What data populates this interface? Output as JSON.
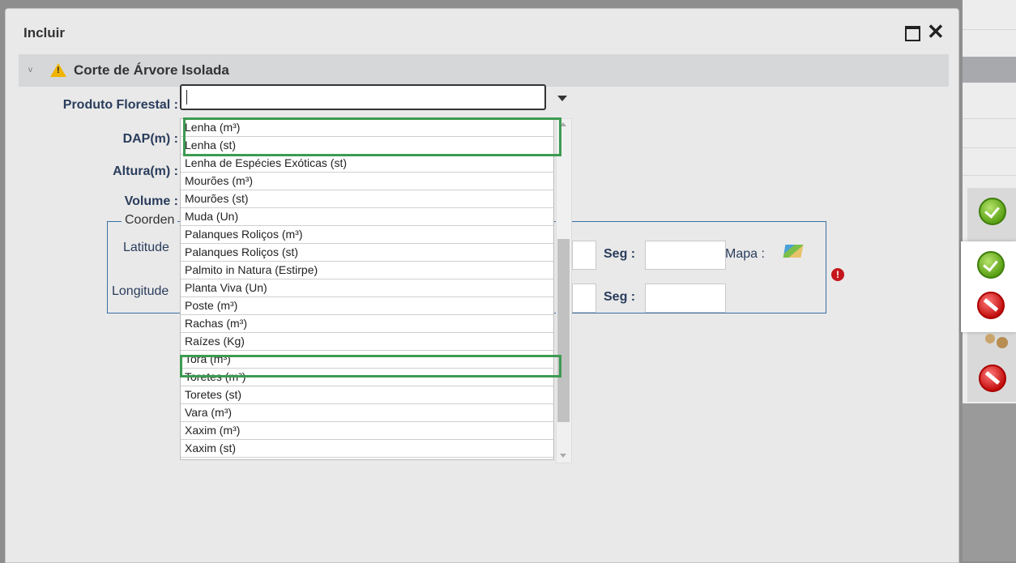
{
  "dialog": {
    "title": "Incluir",
    "section_title": "Corte de Árvore Isolada"
  },
  "form": {
    "produto_label": "Produto Florestal :",
    "produto_value": "",
    "dap_label": "DAP(m) :",
    "altura_label": "Altura(m) :",
    "volume_label": "Volume :",
    "coord_legend": "Coorden",
    "latitude_label": "Latitude",
    "longitude_label": "Longitude",
    "seg_label": "Seg :",
    "mapa_label": "Mapa :"
  },
  "dropdown": {
    "options": [
      "Lenha (m³)",
      "Lenha (st)",
      "Lenha de Espécies Exóticas (st)",
      "Mourões (m³)",
      "Mourões (st)",
      "Muda (Un)",
      "Palanques Roliços (m³)",
      "Palanques Roliços (st)",
      "Palmito in Natura (Estirpe)",
      "Planta Viva (Un)",
      "Poste (m³)",
      "Rachas (m³)",
      "Raízes (Kg)",
      "Tora (m³)",
      "Toretes (m³)",
      "Toretes (st)",
      "Vara (m³)",
      "Xaxim (m³)",
      "Xaxim (st)"
    ],
    "highlighted": [
      "Lenha (m³)",
      "Lenha (st)",
      "Tora (m³)"
    ]
  },
  "colors": {
    "highlight": "#3c9b51",
    "label": "#2a3d5c",
    "section_bg": "#d5d7d8"
  },
  "icons": [
    "warning-icon",
    "maximize-icon",
    "close-icon",
    "map-icon",
    "error-icon",
    "confirm-icon",
    "cancel-icon",
    "users-icon"
  ]
}
